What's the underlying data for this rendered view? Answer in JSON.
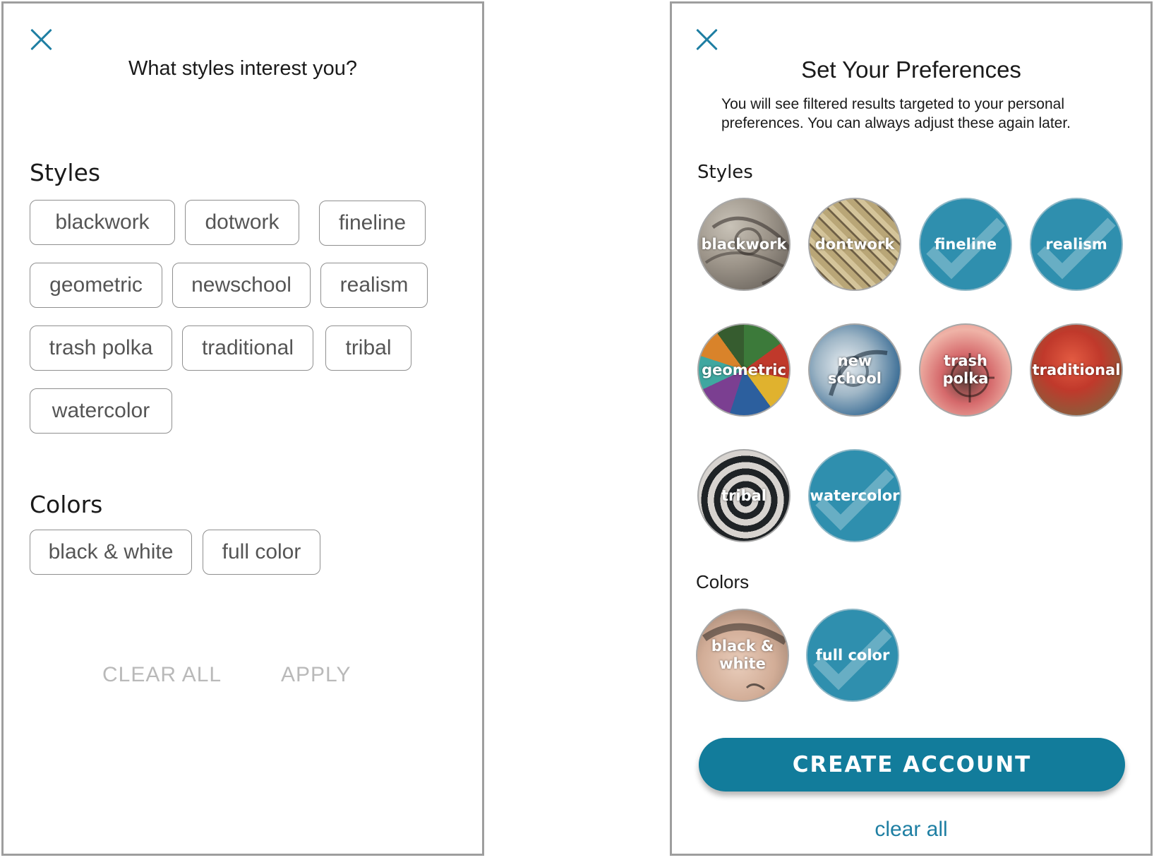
{
  "left_panel": {
    "title": "What styles interest you?",
    "styles_heading": "Styles",
    "styles": [
      "blackwork",
      "dotwork",
      "fineline",
      "geometric",
      "newschool",
      "realism",
      "trash polka",
      "traditional",
      "tribal",
      "watercolor"
    ],
    "colors_heading": "Colors",
    "colors": [
      "black & white",
      "full color"
    ],
    "clear_all_label": "CLEAR ALL",
    "apply_label": "APPLY",
    "button_text_color": "#b9b9b9"
  },
  "right_panel": {
    "title": "Set Your Preferences",
    "description": "You will see filtered results targeted to your personal preferences. You can always adjust these again later.",
    "styles_heading": "Styles",
    "styles": [
      {
        "label": "blackwork",
        "selected": false
      },
      {
        "label": "dontwork",
        "selected": false
      },
      {
        "label": "fineline",
        "selected": true
      },
      {
        "label": "realism",
        "selected": true
      },
      {
        "label": "geometric",
        "selected": false
      },
      {
        "label": "new school",
        "selected": false
      },
      {
        "label": "trash polka",
        "selected": false
      },
      {
        "label": "traditional",
        "selected": false
      },
      {
        "label": "tribal",
        "selected": false
      },
      {
        "label": "watercolor",
        "selected": true
      }
    ],
    "colors_heading": "Colors",
    "colors": [
      {
        "label": "black & white",
        "selected": false
      },
      {
        "label": "full color",
        "selected": true
      }
    ],
    "create_account_label": "CREATE ACCOUNT",
    "clear_all_label": "clear all"
  },
  "colors": {
    "accent": "#127c9b",
    "selected_circle": "#2f8fae",
    "close_icon": "#1f7fa3"
  },
  "icons": [
    "close-icon",
    "checkmark-icon"
  ]
}
